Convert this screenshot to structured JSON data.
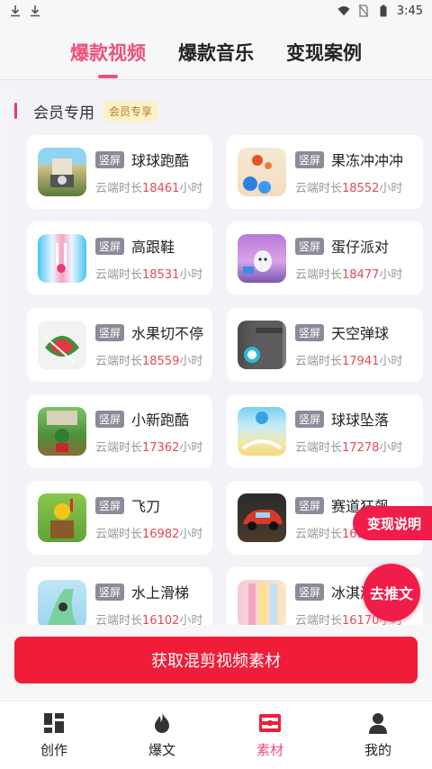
{
  "status_bar": {
    "time": "3:45"
  },
  "tabs": [
    {
      "label": "爆款视频",
      "active": true
    },
    {
      "label": "爆款音乐",
      "active": false
    },
    {
      "label": "变现案例",
      "active": false
    }
  ],
  "section": {
    "title": "会员专用",
    "badge": "会员专享"
  },
  "game_tag": "竖屏",
  "hours_prefix": "云端时长",
  "hours_suffix": "小时",
  "games": [
    {
      "name": "球球跑酷",
      "hours": "18461",
      "icon": "runner-bridge-icon"
    },
    {
      "name": "果冻冲冲冲",
      "hours": "18552",
      "icon": "jelly-balls-icon"
    },
    {
      "name": "高跟鞋",
      "hours": "18531",
      "icon": "high-heels-runway-icon"
    },
    {
      "name": "蛋仔派对",
      "hours": "18477",
      "icon": "eggy-party-icon"
    },
    {
      "name": "水果切不停",
      "hours": "18559",
      "icon": "fruit-slice-icon"
    },
    {
      "name": "天空弹球",
      "hours": "17941",
      "icon": "sky-ball-icon"
    },
    {
      "name": "小新跑酷",
      "hours": "17362",
      "icon": "crayon-runner-icon"
    },
    {
      "name": "球球坠落",
      "hours": "17278",
      "icon": "falling-ball-icon"
    },
    {
      "name": "飞刀",
      "hours": "16982",
      "icon": "flying-knife-icon"
    },
    {
      "name": "赛道狂飙",
      "hours": "16960",
      "icon": "race-car-icon"
    },
    {
      "name": "水上滑梯",
      "hours": "16102",
      "icon": "water-slide-icon"
    },
    {
      "name": "冰淇淋",
      "hours": "16170",
      "icon": "ice-cream-icon"
    }
  ],
  "float_explain": "变现说明",
  "float_push": "去推文",
  "action_button": "获取混剪视频素材",
  "bottom_nav": [
    {
      "label": "创作",
      "icon": "grid-icon",
      "active": false
    },
    {
      "label": "爆文",
      "icon": "flame-icon",
      "active": false
    },
    {
      "label": "素材",
      "icon": "film-icon",
      "active": true
    },
    {
      "label": "我的",
      "icon": "person-icon",
      "active": false
    }
  ],
  "colors": {
    "accent": "#f0507a",
    "primary_red": "#f01d38",
    "hours_number": "#e24a56"
  }
}
